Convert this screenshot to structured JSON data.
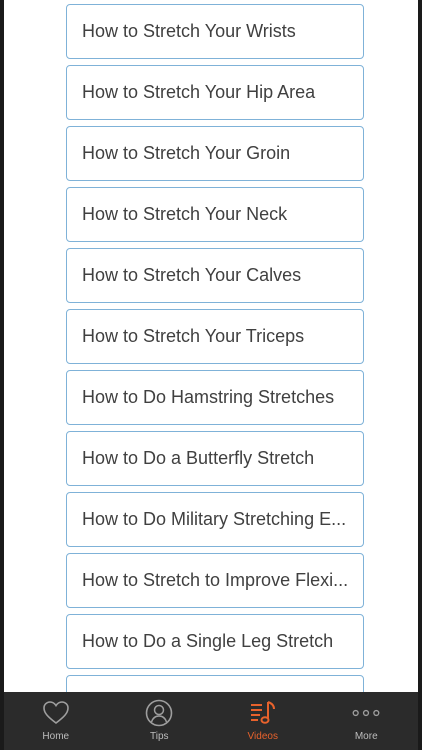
{
  "list": {
    "items": [
      {
        "label": "How to Stretch Your Wrists"
      },
      {
        "label": "How to Stretch Your Hip Area"
      },
      {
        "label": "How to Stretch Your Groin"
      },
      {
        "label": "How to Stretch Your Neck"
      },
      {
        "label": "How to Stretch Your Calves"
      },
      {
        "label": "How to Stretch Your Triceps"
      },
      {
        "label": "How to Do Hamstring Stretches"
      },
      {
        "label": "How to Do a Butterfly Stretch"
      },
      {
        "label": "How to Do Military Stretching E..."
      },
      {
        "label": "How to Stretch to Improve Flexi..."
      },
      {
        "label": "How to Do a Single Leg Stretch"
      },
      {
        "label": ""
      }
    ]
  },
  "tabbar": {
    "tabs": [
      {
        "label": "Home",
        "icon": "heart-icon"
      },
      {
        "label": "Tips",
        "icon": "person-icon"
      },
      {
        "label": "Videos",
        "icon": "music-list-icon",
        "active": true
      },
      {
        "label": "More",
        "icon": "more-dots-icon"
      }
    ]
  },
  "colors": {
    "tabbar_bg": "#2b2b2b",
    "active_accent": "#e8622c",
    "inactive_icon": "#9e9e9e",
    "item_border": "#7fb2d8",
    "item_text": "#404040"
  }
}
